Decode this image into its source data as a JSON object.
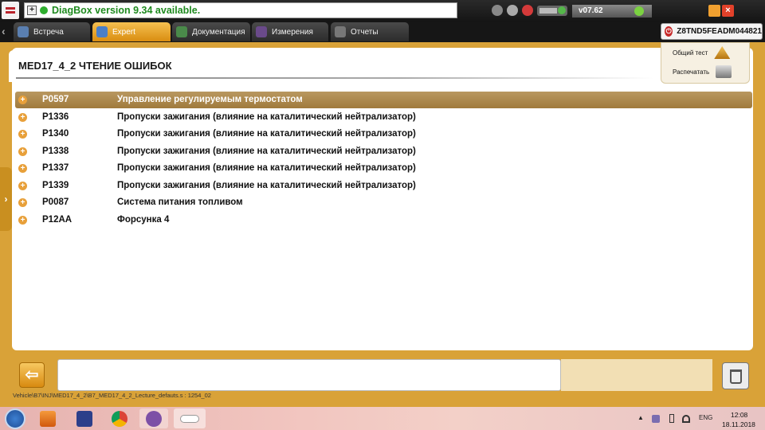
{
  "topbar": {
    "notice_text": "DiagBox version 9.34 available.",
    "notice_icon": "plus-box-icon",
    "version": "v07.62"
  },
  "tabs": [
    {
      "label": "Встреча",
      "icon": "meeting-icon",
      "active": false
    },
    {
      "label": "Expert",
      "icon": "expert-folder-icon",
      "active": true
    },
    {
      "label": "Документация",
      "icon": "documentation-icon",
      "active": false
    },
    {
      "label": "Измерения",
      "icon": "measurement-icon",
      "active": false
    },
    {
      "label": "Отчеты",
      "icon": "reports-icon",
      "active": false
    }
  ],
  "vin": "Z8TND5FEADM044821",
  "screen": {
    "title": "MED17_4_2 ЧТЕНИЕ ОШИБОК"
  },
  "side_panel": {
    "global_test_label": "Общий тест",
    "print_label": "Распечатать"
  },
  "faults": [
    {
      "code": "P0597",
      "description": "Управление регулируемым термостатом",
      "selected": true
    },
    {
      "code": "P1336",
      "description": "Пропуски зажигания (влияние на каталитический нейтрализатор)",
      "selected": false
    },
    {
      "code": "P1340",
      "description": "Пропуски зажигания (влияние на каталитический нейтрализатор)",
      "selected": false
    },
    {
      "code": "P1338",
      "description": "Пропуски зажигания (влияние на каталитический нейтрализатор)",
      "selected": false
    },
    {
      "code": "P1337",
      "description": "Пропуски зажигания (влияние на каталитический нейтрализатор)",
      "selected": false
    },
    {
      "code": "P1339",
      "description": "Пропуски зажигания (влияние на каталитический нейтрализатор)",
      "selected": false
    },
    {
      "code": "P0087",
      "description": "Система питания топливом",
      "selected": false
    },
    {
      "code": "P12AA",
      "description": "Форсунка 4",
      "selected": false
    }
  ],
  "footer": {
    "back_label": "⇦",
    "path": "Vehicle\\B7\\INJ\\MED17_4_2\\B7_MED17_4_2_Lecture_defauts.s : 1254_02"
  },
  "taskbar": {
    "apps": [
      "media-player-icon",
      "diagbox-save-icon",
      "chrome-icon",
      "viber-icon",
      "app-window-icon"
    ],
    "language": "ENG",
    "time": "12:08",
    "date": "18.11.2018"
  },
  "colors": {
    "frame": "#d9a238",
    "selected_row": "#a88448",
    "tab_active": "#e8a020",
    "notice_text": "#1f8a1f"
  }
}
